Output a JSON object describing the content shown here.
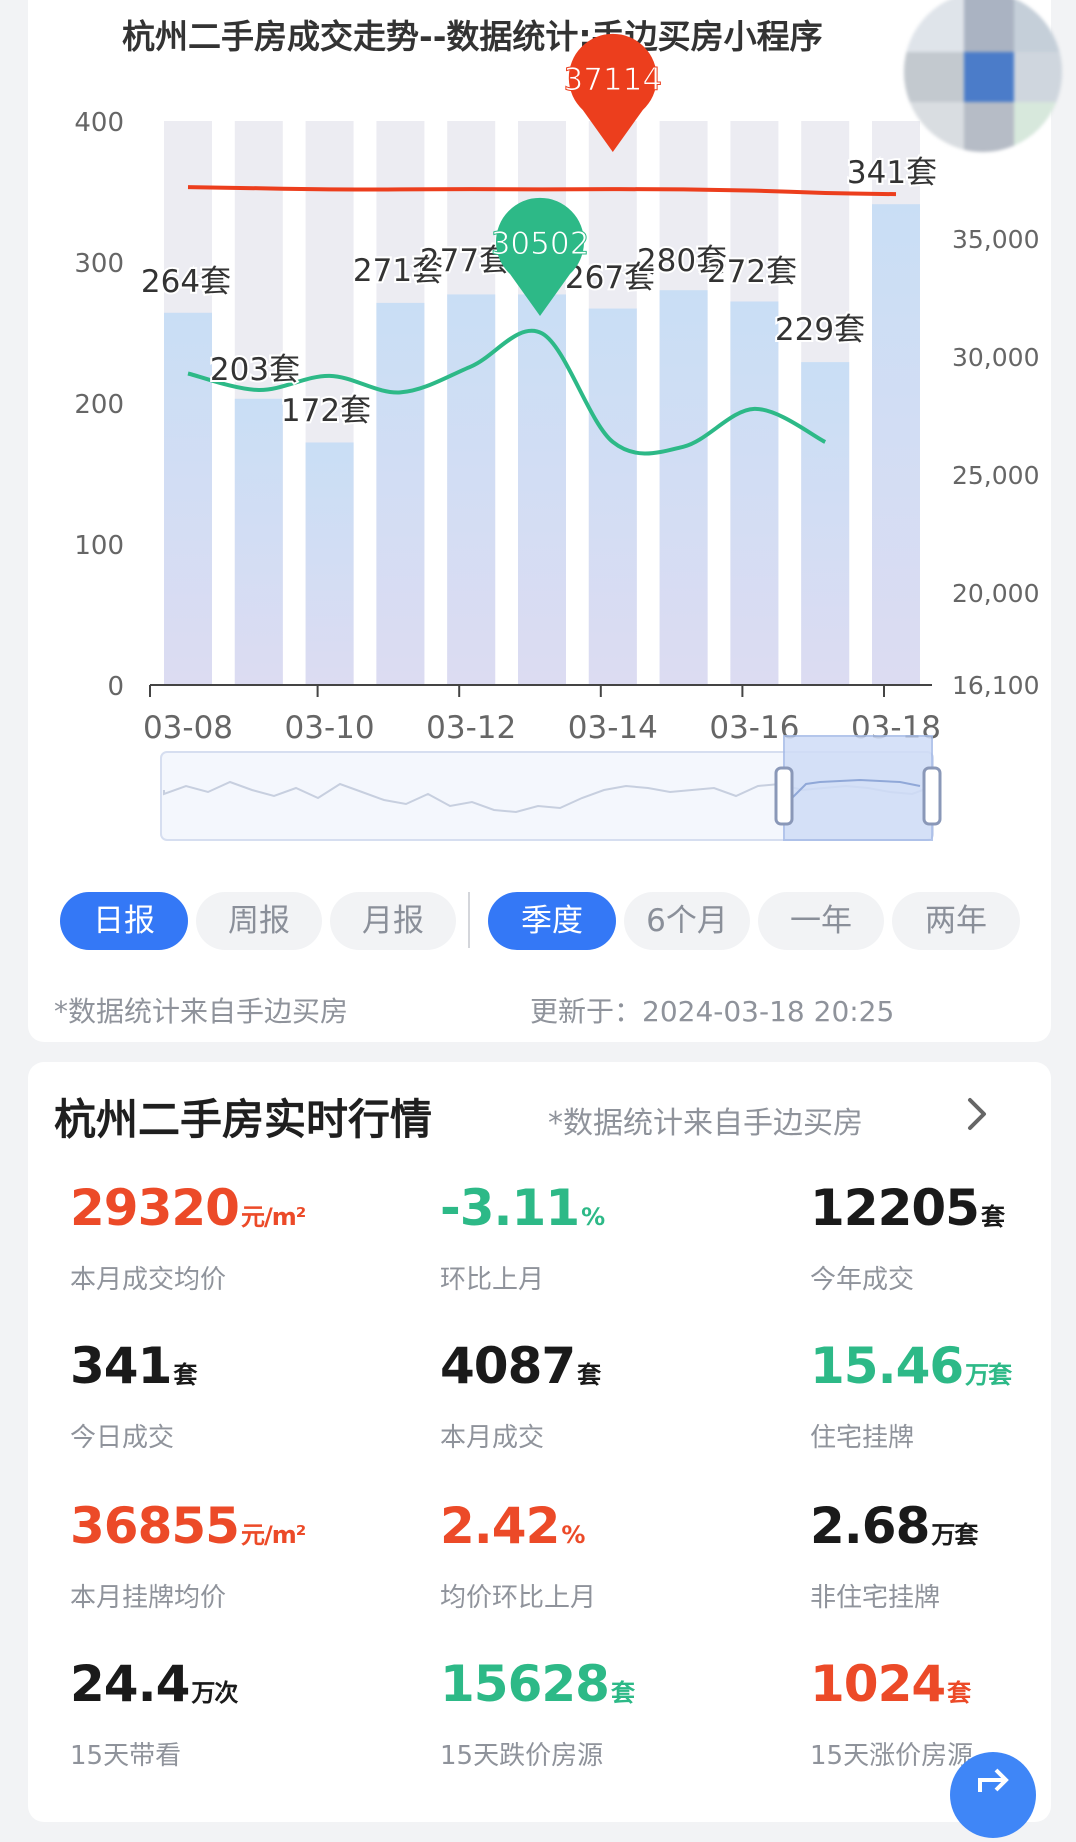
{
  "chart_data": {
    "type": "bar",
    "title": "杭州二手房成交走势--数据统计:手边买房小程序",
    "categories": [
      "03-08",
      "03-09",
      "03-10",
      "03-11",
      "03-12",
      "03-13",
      "03-14",
      "03-15",
      "03-16",
      "03-17",
      "03-18"
    ],
    "x_tick_labels": [
      "03-08",
      "03-10",
      "03-12",
      "03-14",
      "03-16",
      "03-18"
    ],
    "y_left": {
      "ticks": [
        "0",
        "100",
        "200",
        "300",
        "400"
      ],
      "ylim": [
        0,
        400
      ]
    },
    "y_right": {
      "ticks": [
        "16,100",
        "20,000",
        "25,000",
        "30,000",
        "35,000"
      ],
      "ylim": [
        16100,
        40000
      ]
    },
    "series": [
      {
        "values": [
          264,
          203,
          172,
          271,
          277,
          277,
          267,
          280,
          272,
          229,
          341
        ],
        "labels": [
          "264套",
          "203套",
          "172套",
          "271套",
          "277套",
          "",
          "267套",
          "280套",
          "272套",
          "229套",
          "341套"
        ],
        "color": "#c7dcf4"
      },
      {
        "values": [
          29300,
          28600,
          29200,
          28500,
          29600,
          31000,
          26400,
          26200,
          27800,
          26400,
          null
        ],
        "color": "#2db987",
        "max_marker": "30502"
      },
      {
        "values": [
          37200,
          37150,
          37100,
          37100,
          37114,
          37100,
          37114,
          37100,
          37050,
          36950,
          36900
        ],
        "color": "#ec3e1d",
        "max_marker": "37114"
      }
    ],
    "grid": false
  },
  "tabs_period": [
    {
      "label": "日报",
      "active": true
    },
    {
      "label": "周报",
      "active": false
    },
    {
      "label": "月报",
      "active": false
    }
  ],
  "tabs_range": [
    {
      "label": "季度",
      "active": true
    },
    {
      "label": "6个月",
      "active": false
    },
    {
      "label": "一年",
      "active": false
    },
    {
      "label": "两年",
      "active": false
    }
  ],
  "chart_note": "*数据统计来自手边买房",
  "updated_at": "更新于：2024-03-18 20:25",
  "section": {
    "title": "杭州二手房实时行情",
    "note": "*数据统计来自手边买房"
  },
  "stats": [
    {
      "value": "29320",
      "unit": "元/m²",
      "label": "本月成交均价",
      "color": "red"
    },
    {
      "value": "-3.11",
      "unit": "%",
      "label": "环比上月",
      "color": "green"
    },
    {
      "value": "12205",
      "unit": "套",
      "label": "今年成交",
      "color": "black"
    },
    {
      "value": "341",
      "unit": "套",
      "label": "今日成交",
      "color": "black"
    },
    {
      "value": "4087",
      "unit": "套",
      "label": "本月成交",
      "color": "black"
    },
    {
      "value": "15.46",
      "unit": "万套",
      "label": "住宅挂牌",
      "color": "green"
    },
    {
      "value": "36855",
      "unit": "元/m²",
      "label": "本月挂牌均价",
      "color": "red"
    },
    {
      "value": "2.42",
      "unit": "%",
      "label": "均价环比上月",
      "color": "red"
    },
    {
      "value": "2.68",
      "unit": "万套",
      "label": "非住宅挂牌",
      "color": "black"
    },
    {
      "value": "24.4",
      "unit": "万次",
      "label": "15天带看",
      "color": "black"
    },
    {
      "value": "15628",
      "unit": "套",
      "label": "15天跌价房源",
      "color": "green"
    },
    {
      "value": "1024",
      "unit": "套",
      "label": "15天涨价房源",
      "color": "red"
    }
  ]
}
